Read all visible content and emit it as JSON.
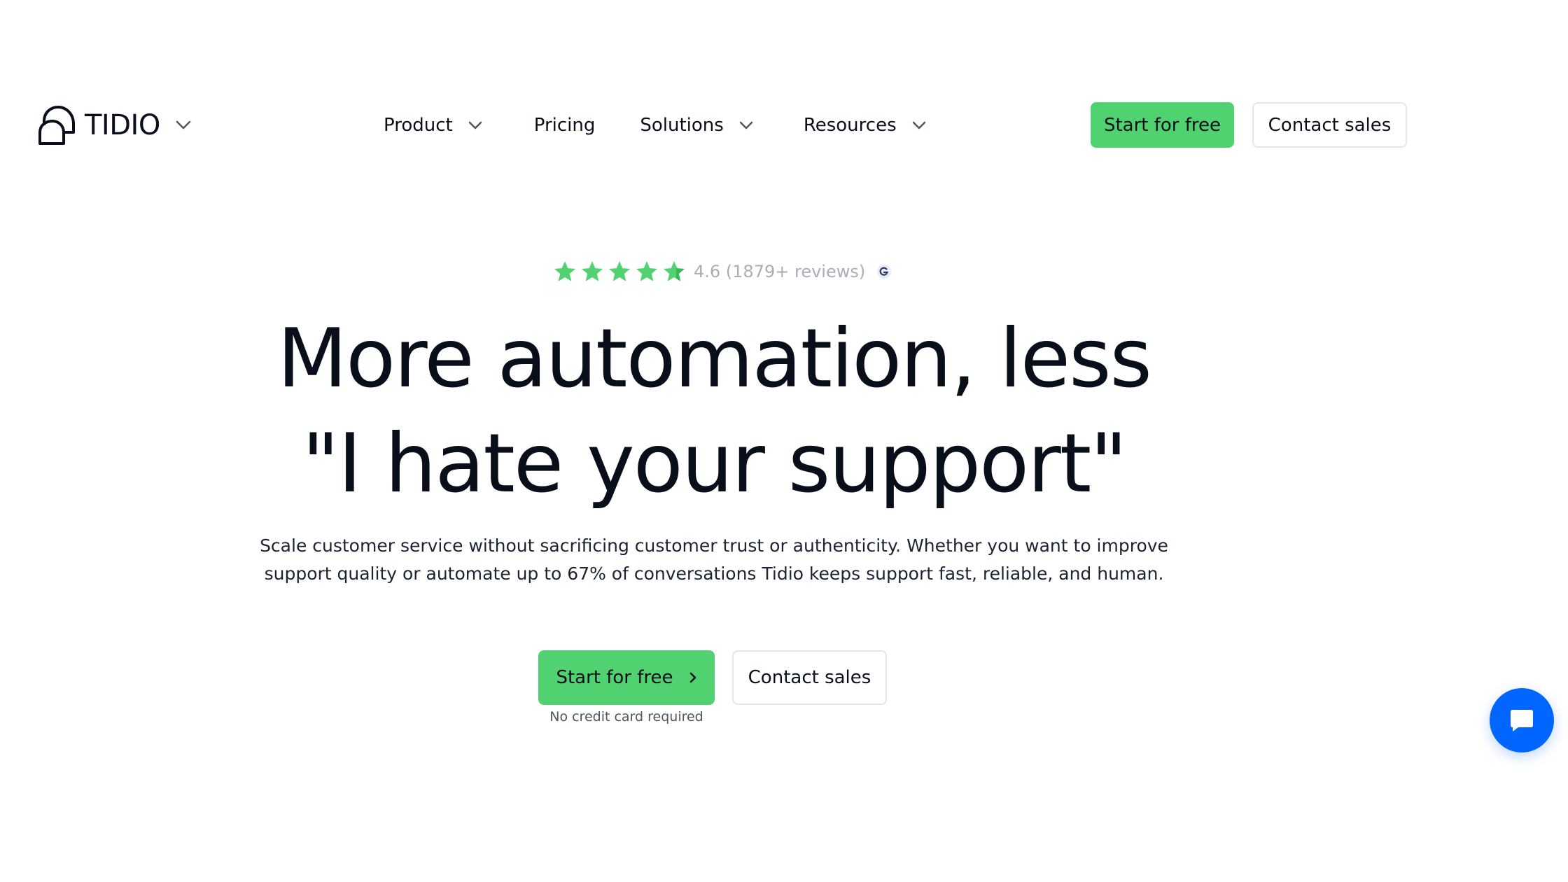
{
  "header": {
    "logo_text": "TIDIO",
    "nav": [
      {
        "label": "Product"
      },
      {
        "label": "Pricing"
      },
      {
        "label": "Solutions"
      },
      {
        "label": "Resources"
      }
    ],
    "start_label": "Start for free",
    "contact_label": "Contact sales"
  },
  "hero": {
    "rating": {
      "stars": 4.6,
      "max_stars": 5,
      "text": "4.6 (1879+ reviews)",
      "source_icon": "g2-icon"
    },
    "headline_line1": "More automation, less",
    "headline_line2": "\"I hate your support\"",
    "subtext_line1": "Scale customer service without sacrificing customer trust or authenticity. Whether you want to improve",
    "subtext_line2": "support quality or automate up to 67% of conversations Tidio keeps support fast, reliable, and human.",
    "start_label": "Start for free",
    "contact_label": "Contact sales",
    "no_cc": "No credit card required"
  },
  "chat_widget": {
    "icon": "chat-bubble-icon"
  },
  "colors": {
    "accent_green": "#4fd26f",
    "star_green": "#4fd26f",
    "chat_blue": "#0066ff",
    "text_dark": "#080f1a",
    "muted_gray": "#a8aeb8"
  }
}
